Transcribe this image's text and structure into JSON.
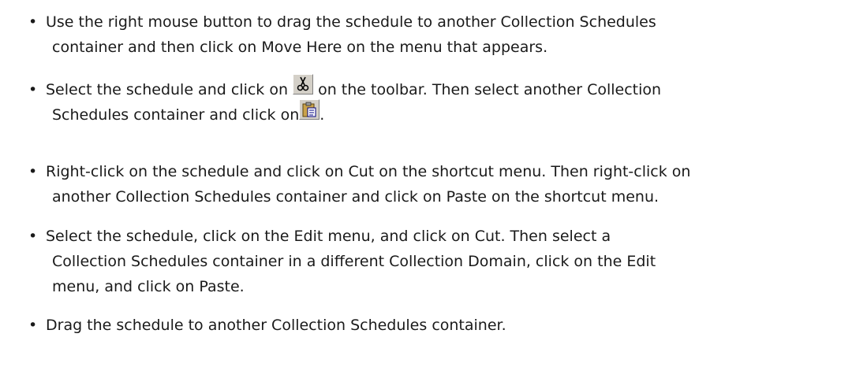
{
  "bullet_char": "•",
  "items": [
    {
      "lines": [
        "Use the right mouse button to drag the schedule to another Collection Schedules",
        "container and then click on Move Here on the menu that appears."
      ]
    },
    {
      "line1_before_icon": "Select the schedule and click on ",
      "cut_icon": "cut-scissors-icon",
      "line1_after_icon": " on the toolbar. Then select another Collection",
      "line2_before_icon": "Schedules container and click on",
      "paste_icon": "paste-clipboard-icon",
      "line2_after_icon": "."
    },
    {
      "lines": [
        "Right-click on the schedule and click on Cut on the shortcut menu. Then right-click on",
        "another Collection Schedules container and click on Paste on the shortcut menu."
      ]
    },
    {
      "lines": [
        "Select the schedule, click on the Edit menu, and click on Cut. Then select a",
        "Collection Schedules container in a different Collection Domain, click on the Edit",
        "menu, and click on Paste."
      ]
    },
    {
      "lines": [
        "Drag the schedule to another Collection Schedules container."
      ]
    }
  ]
}
